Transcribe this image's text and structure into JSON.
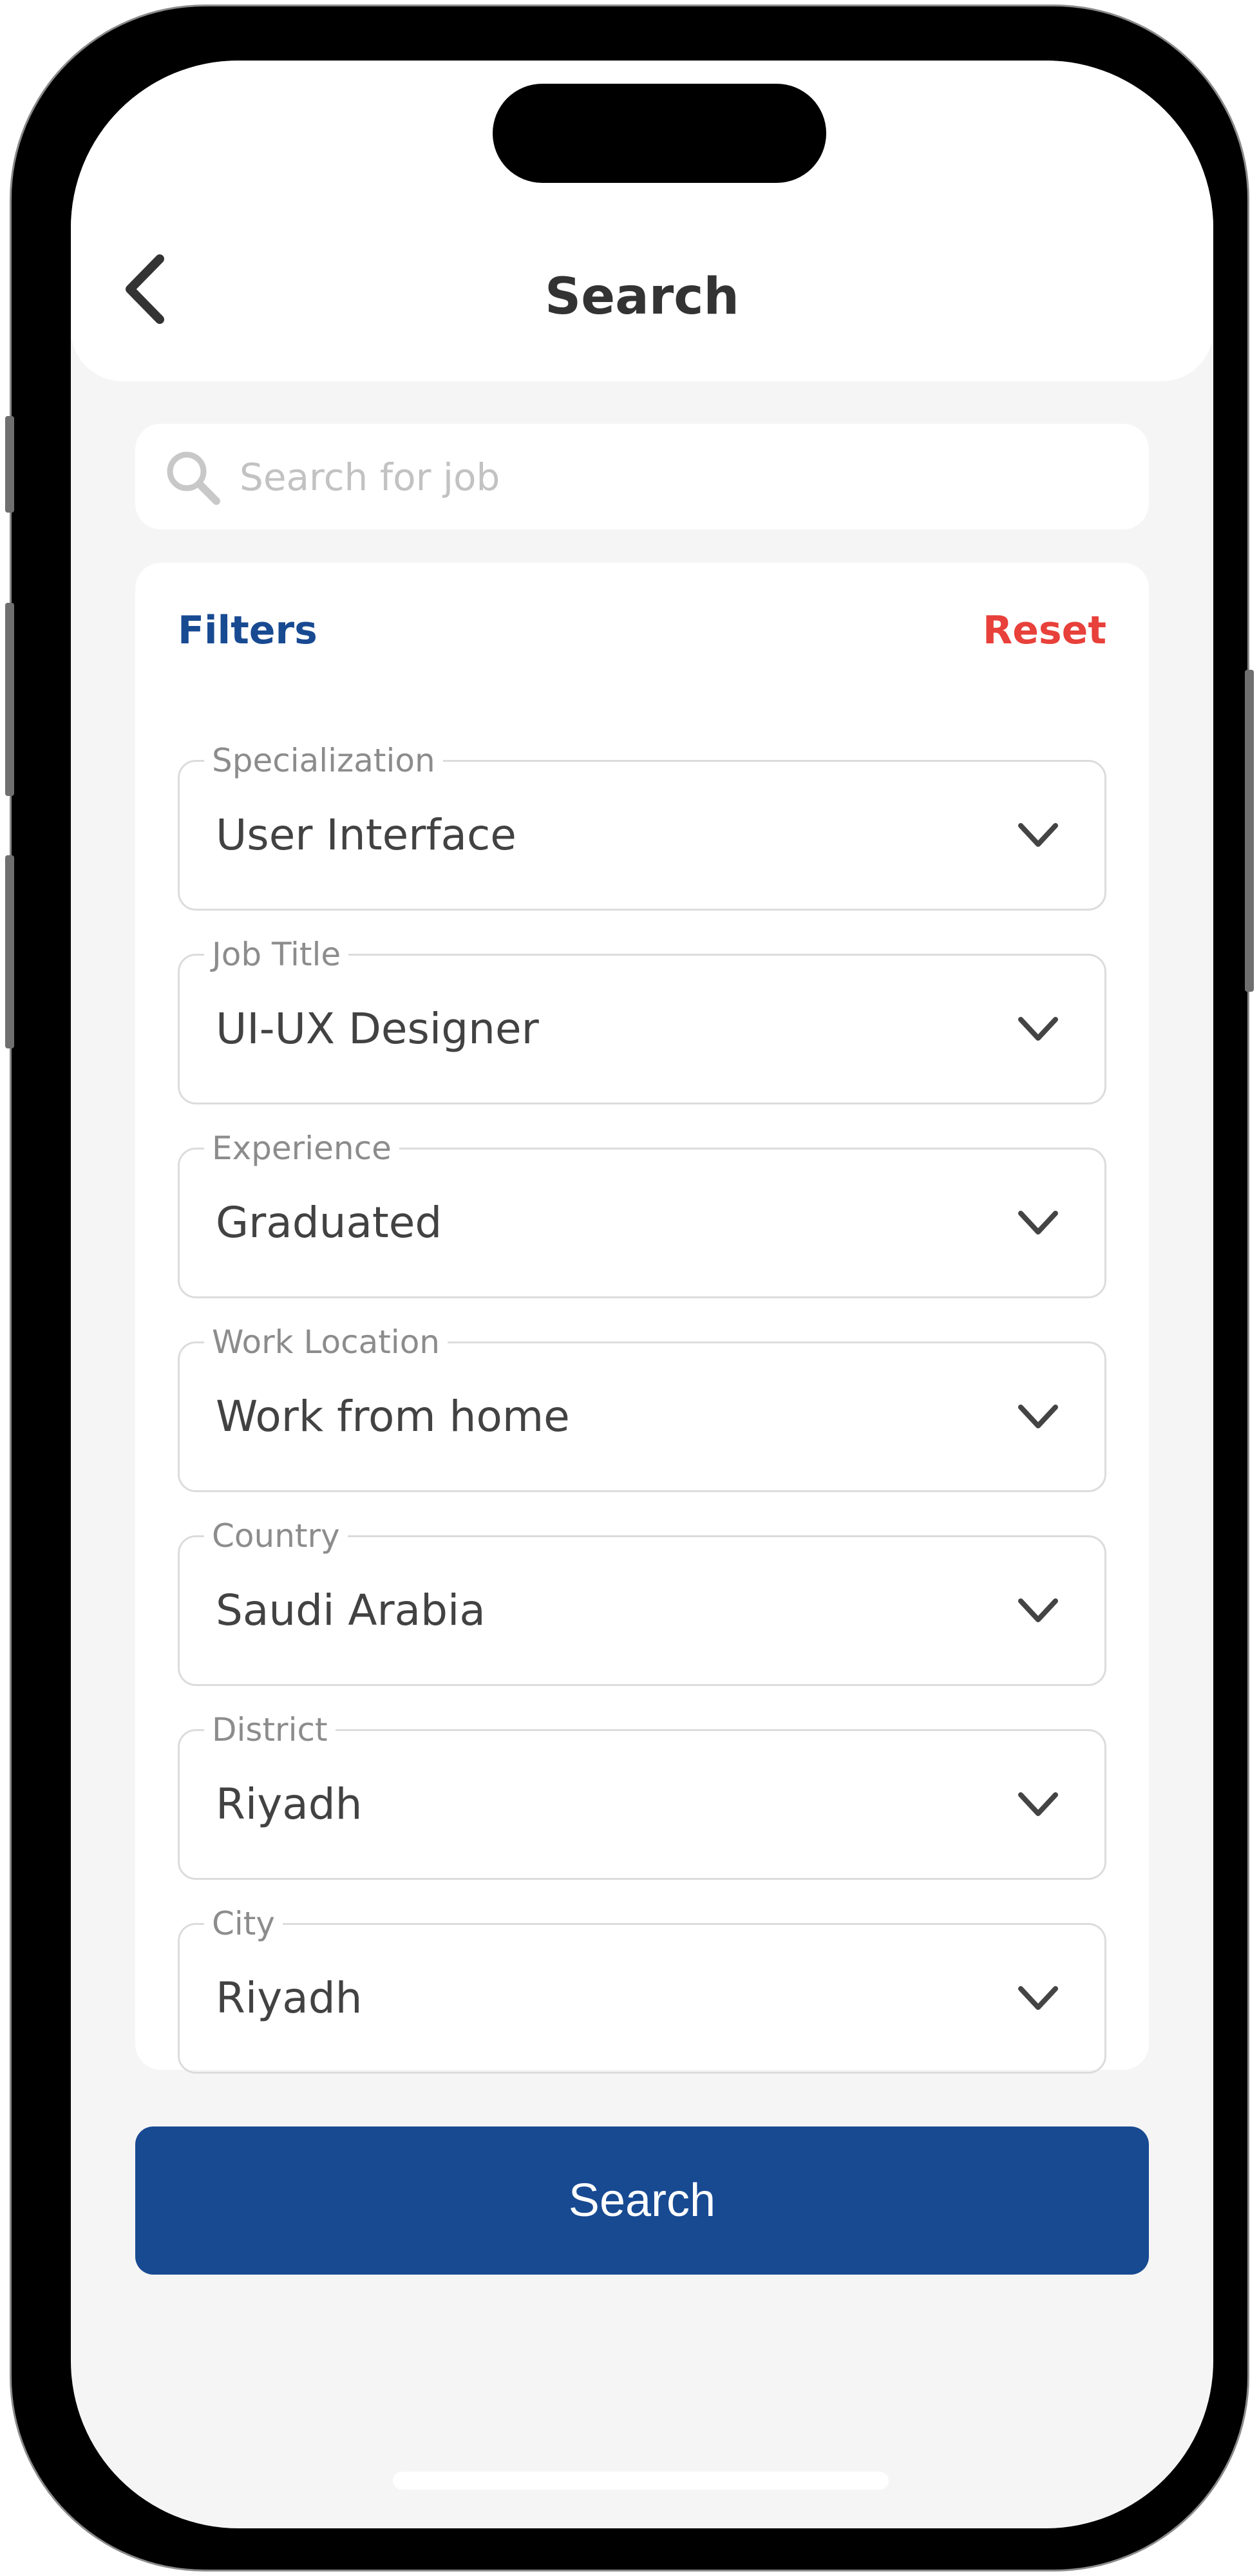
{
  "header": {
    "title": "Search"
  },
  "search": {
    "placeholder": "Search for job"
  },
  "filters": {
    "title": "Filters",
    "reset_label": "Reset",
    "fields": [
      {
        "label": "Specialization",
        "value": "User Interface"
      },
      {
        "label": "Job Title",
        "value": "UI-UX Designer"
      },
      {
        "label": "Experience",
        "value": "Graduated"
      },
      {
        "label": "Work Location",
        "value": "Work from home"
      },
      {
        "label": "Country",
        "value": "Saudi Arabia"
      },
      {
        "label": "District",
        "value": "Riyadh"
      },
      {
        "label": "City",
        "value": "Riyadh"
      }
    ]
  },
  "actions": {
    "search_label": "Search"
  },
  "colors": {
    "primary": "#184a92",
    "reset": "#e8403a",
    "background": "#f5f5f5",
    "card": "#ffffff"
  },
  "icons": {
    "back": "chevron-left-icon",
    "search": "search-icon",
    "dropdown": "chevron-down-icon"
  }
}
